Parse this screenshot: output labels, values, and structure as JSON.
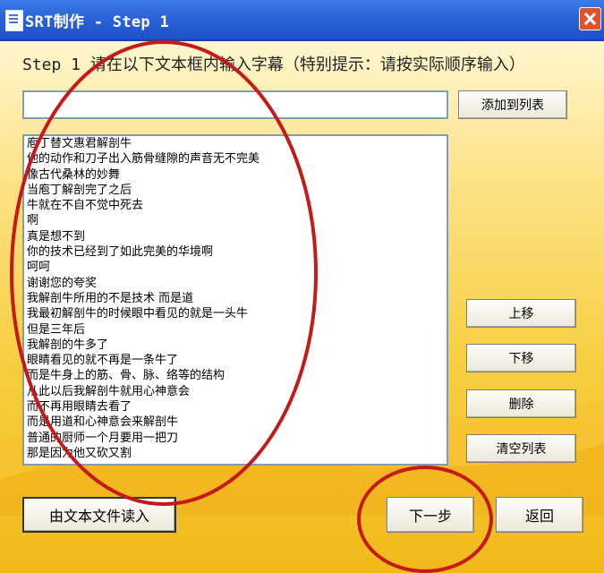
{
  "window": {
    "title": "SRT制作 - Step 1"
  },
  "instruction": "Step 1  请在以下文本框内输入字幕（特别提示：请按实际顺序输入）",
  "input": {
    "value": ""
  },
  "buttons": {
    "add": "添加到列表",
    "up": "上移",
    "down": "下移",
    "delete": "删除",
    "clear": "清空列表",
    "load": "由文本文件读入",
    "next": "下一步",
    "back": "返回"
  },
  "list": [
    "庖丁替文惠君解剖牛",
    "他的动作和刀子出入筋骨缝隙的声音无不完美",
    "像古代桑林的妙舞",
    "当庖丁解剖完了之后",
    "牛就在不自不觉中死去",
    "啊",
    "真是想不到",
    "你的技术已经到了如此完美的华境啊",
    "呵呵",
    "谢谢您的夸奖",
    "我解剖牛所用的不是技术 而是道",
    "我最初解剖牛的时候眼中看见的就是一头牛",
    "但是三年后",
    "我解剖的牛多了",
    "眼睛看见的就不再是一条牛了",
    "而是牛身上的筋、骨、脉、络等的结构",
    "从此以后我解剖牛就用心神意会",
    "而不再用眼睛去看了",
    "而是用道和心神意会来解剖牛",
    "普通的厨师一个月要用一把刀",
    "那是因为他又砍又割"
  ],
  "colors": {
    "annotation": "#c41a1a",
    "titlebar": "#2a63d8"
  }
}
